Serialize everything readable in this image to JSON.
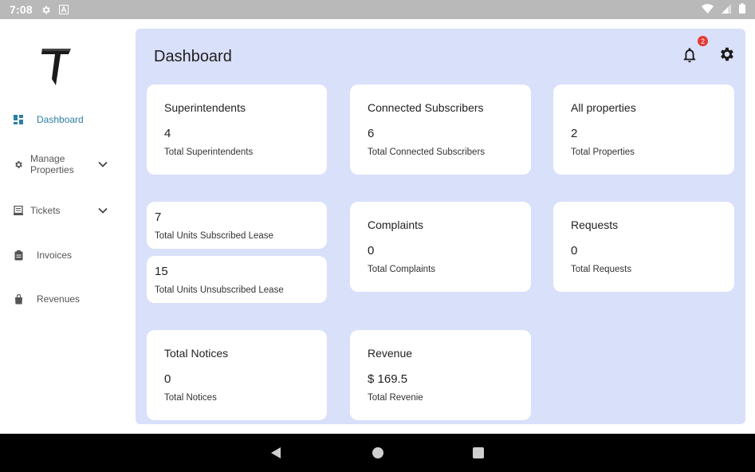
{
  "status_bar": {
    "time": "7:08"
  },
  "app": {
    "logo_letter": "T"
  },
  "sidebar": {
    "items": [
      {
        "label": "Dashboard",
        "icon": "dashboard-icon",
        "active": true
      },
      {
        "label": "Manage Properties",
        "icon": "gear-icon",
        "expandable": true
      },
      {
        "label": "Tickets",
        "icon": "ticket-icon",
        "expandable": true
      },
      {
        "label": "Invoices",
        "icon": "clipboard-icon"
      },
      {
        "label": "Revenues",
        "icon": "shopping-bag-icon"
      }
    ]
  },
  "header": {
    "title": "Dashboard",
    "notification_count": "2"
  },
  "cards": {
    "superintendents": {
      "title": "Superintendents",
      "value": "4",
      "subtitle": "Total Superintendents"
    },
    "connected_subscribers": {
      "title": "Connected Subscribers",
      "value": "6",
      "subtitle": "Total Connected Subscribers"
    },
    "all_properties": {
      "title": "All properties",
      "value": "2",
      "subtitle": "Total Properties"
    },
    "units_subscribed": {
      "value": "7",
      "subtitle": "Total Units Subscribed Lease"
    },
    "units_unsubscribed": {
      "value": "15",
      "subtitle": "Total Units Unsubscribed Lease"
    },
    "complaints": {
      "title": "Complaints",
      "value": "0",
      "subtitle": "Total Complaints"
    },
    "requests": {
      "title": "Requests",
      "value": "0",
      "subtitle": "Total Requests"
    },
    "notices": {
      "title": "Total Notices",
      "value": "0",
      "subtitle": "Total Notices"
    },
    "revenue": {
      "title": "Revenue",
      "value": "$ 169.5",
      "subtitle": "Total Revenie"
    }
  },
  "colors": {
    "panel_bg": "#d9e0fa",
    "active_nav": "#2c7fa3",
    "badge": "#e53935"
  }
}
